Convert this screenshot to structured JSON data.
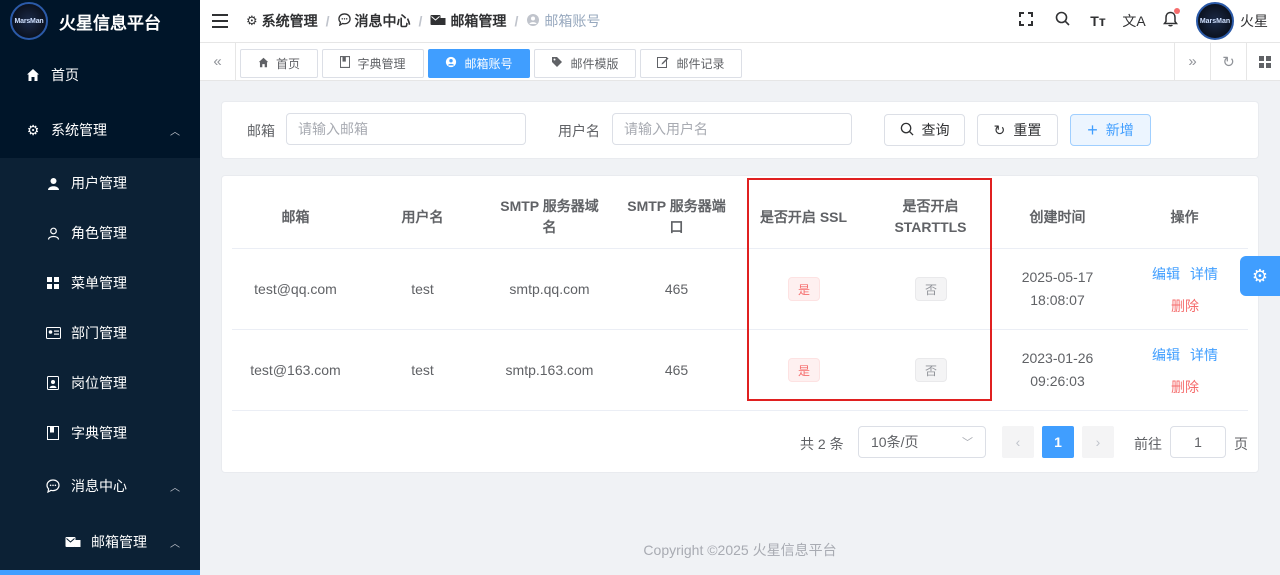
{
  "brand": {
    "logo_text": "MarsMan",
    "title": "火星信息平台"
  },
  "sidebar": {
    "items": [
      {
        "label": "首页"
      },
      {
        "label": "系统管理"
      },
      {
        "label": "用户管理"
      },
      {
        "label": "角色管理"
      },
      {
        "label": "菜单管理"
      },
      {
        "label": "部门管理"
      },
      {
        "label": "岗位管理"
      },
      {
        "label": "字典管理"
      },
      {
        "label": "消息中心"
      },
      {
        "label": "邮箱管理"
      }
    ]
  },
  "header": {
    "breadcrumb": [
      "系统管理",
      "消息中心",
      "邮箱管理",
      "邮箱账号"
    ],
    "user_name": "火星"
  },
  "tabs": [
    "首页",
    "字典管理",
    "邮箱账号",
    "邮件模版",
    "邮件记录"
  ],
  "search": {
    "email_label": "邮箱",
    "email_placeholder": "请输入邮箱",
    "username_label": "用户名",
    "username_placeholder": "请输入用户名",
    "query_button": "查询",
    "reset_button": "重置",
    "add_button": "新增"
  },
  "table": {
    "columns": [
      "邮箱",
      "用户名",
      "SMTP 服务器域名",
      "SMTP 服务器端口",
      "是否开启 SSL",
      "是否开启 STARTTLS",
      "创建时间",
      "操作"
    ],
    "column_lines": {
      "smtp_host": [
        "SMTP 服务器域",
        "名"
      ],
      "smtp_port": [
        "SMTP 服务器端",
        "口"
      ],
      "starttls": [
        "是否开启",
        "STARTTLS"
      ]
    },
    "rows": [
      {
        "email": "test@qq.com",
        "username": "test",
        "host": "smtp.qq.com",
        "port": "465",
        "ssl": "是",
        "starttls": "否",
        "date": "2025-05-17",
        "time": "18:08:07"
      },
      {
        "email": "test@163.com",
        "username": "test",
        "host": "smtp.163.com",
        "port": "465",
        "ssl": "是",
        "starttls": "否",
        "date": "2023-01-26",
        "time": "09:26:03"
      }
    ],
    "actions": {
      "edit": "编辑",
      "detail": "详情",
      "delete": "删除"
    }
  },
  "pagination": {
    "total": "共 2 条",
    "page_size": "10条/页",
    "current_page": "1",
    "goto_label": "前往",
    "goto_value": "1",
    "page_suffix": "页"
  },
  "footer": "Copyright ©2025 火星信息平台",
  "colors": {
    "sidebar": "#001529",
    "primary": "#409eff",
    "danger": "#f56c6c",
    "highlight": "#e02020"
  }
}
